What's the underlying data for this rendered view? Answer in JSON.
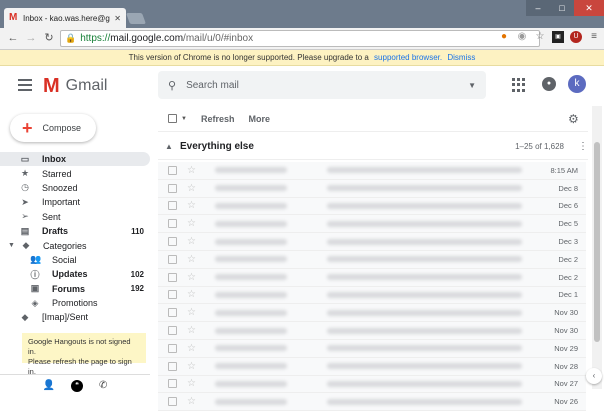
{
  "browser": {
    "tab_title": "Inbox - kao.was.here@gm",
    "url_secure": "https://",
    "url_host": "mail.google.com",
    "url_path": "/mail/u/0/#inbox",
    "warning_text": "This version of Chrome is no longer supported. Please upgrade to a",
    "warning_link": "supported browser.",
    "warning_dismiss": "Dismiss"
  },
  "header": {
    "app_name": "Gmail",
    "search_placeholder": "Search mail",
    "avatar_letter": "k"
  },
  "sidebar": {
    "compose_label": "Compose",
    "items": [
      {
        "label": "Inbox",
        "icon": "inbox-icon",
        "count": "",
        "selected": true,
        "bold": true
      },
      {
        "label": "Starred",
        "icon": "star-icon",
        "count": ""
      },
      {
        "label": "Snoozed",
        "icon": "clock-icon",
        "count": ""
      },
      {
        "label": "Important",
        "icon": "important-icon",
        "count": ""
      },
      {
        "label": "Sent",
        "icon": "send-icon",
        "count": ""
      },
      {
        "label": "Drafts",
        "icon": "drafts-icon",
        "count": "110",
        "bold": true
      },
      {
        "label": "Categories",
        "icon": "label-icon",
        "count": "",
        "category": true
      },
      {
        "label": "Social",
        "icon": "people-icon",
        "count": "",
        "sub": true
      },
      {
        "label": "Updates",
        "icon": "info-icon",
        "count": "102",
        "sub": true,
        "bold": true
      },
      {
        "label": "Forums",
        "icon": "forum-icon",
        "count": "192",
        "sub": true,
        "bold": true
      },
      {
        "label": "Promotions",
        "icon": "tag-icon",
        "count": "",
        "sub": true
      },
      {
        "label": "[Imap]/Sent",
        "icon": "label-icon",
        "count": ""
      }
    ],
    "hangouts_line1": "Google Hangouts is not signed in.",
    "hangouts_line2": "Please refresh the page to sign in."
  },
  "toolbar": {
    "refresh_label": "Refresh",
    "more_label": "More"
  },
  "section": {
    "name": "Everything else",
    "range": "1–25 of 1,628"
  },
  "emails": [
    {
      "date": "8:15 AM"
    },
    {
      "date": "Dec 8"
    },
    {
      "date": "Dec 6"
    },
    {
      "date": "Dec 5"
    },
    {
      "date": "Dec 3"
    },
    {
      "date": "Dec 2"
    },
    {
      "date": "Dec 2"
    },
    {
      "date": "Dec 1"
    },
    {
      "date": "Nov 30"
    },
    {
      "date": "Nov 30"
    },
    {
      "date": "Nov 29"
    },
    {
      "date": "Nov 28"
    },
    {
      "date": "Nov 27"
    },
    {
      "date": "Nov 26"
    }
  ]
}
